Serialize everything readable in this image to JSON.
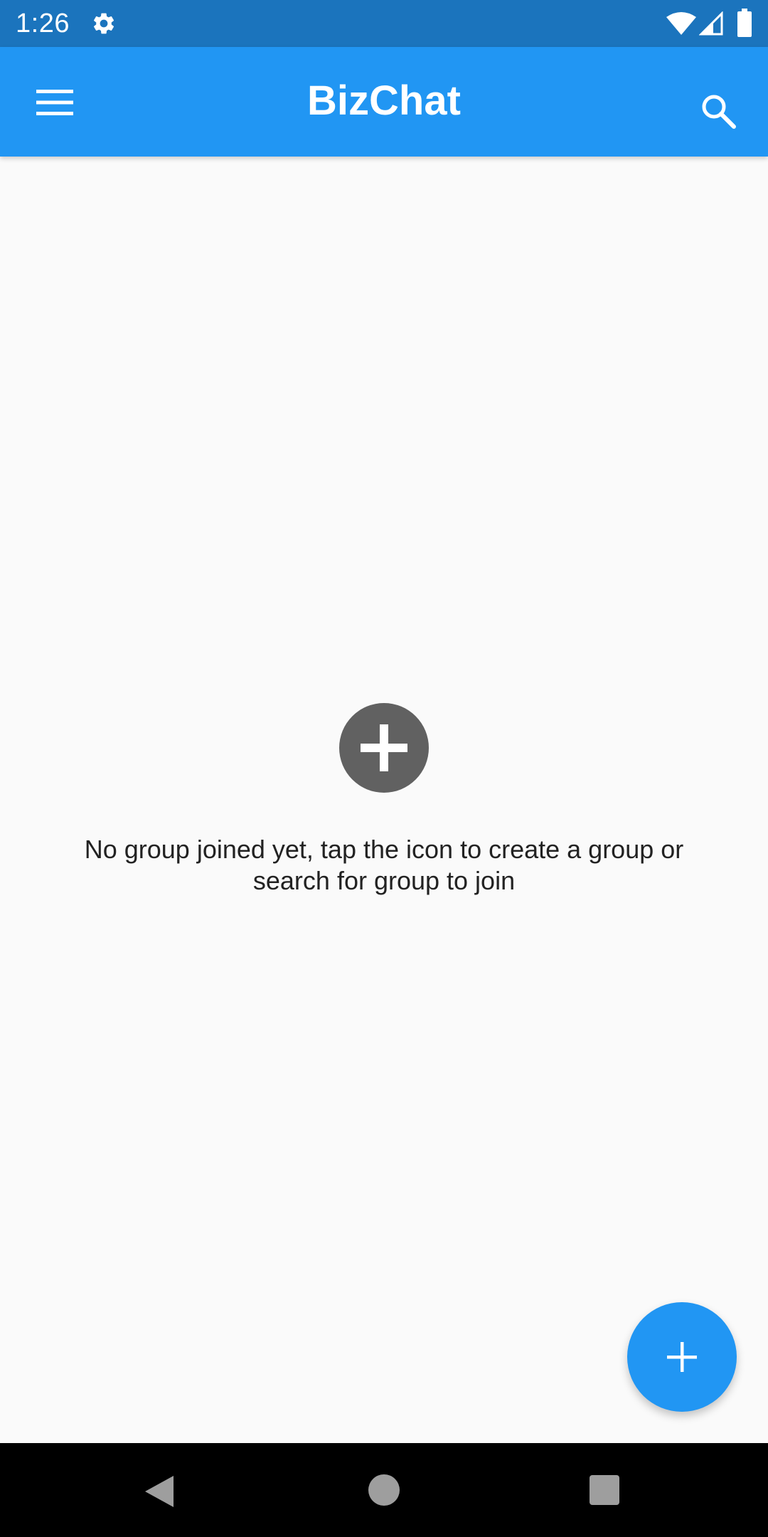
{
  "status_bar": {
    "time": "1:26",
    "icons": [
      "gear-icon",
      "wifi-icon",
      "signal-icon",
      "battery-icon"
    ]
  },
  "app_bar": {
    "title": "BizChat",
    "menu_icon": "hamburger-menu-icon",
    "search_icon": "search-icon",
    "color": "#2196f3"
  },
  "empty_state": {
    "icon": "add-circle-icon",
    "message": "No group joined yet, tap the icon to create a group or search for group to join"
  },
  "fab": {
    "icon": "plus-icon",
    "color": "#2196f3"
  },
  "nav_bar": {
    "buttons": [
      "back-icon",
      "home-icon",
      "recents-icon"
    ]
  }
}
